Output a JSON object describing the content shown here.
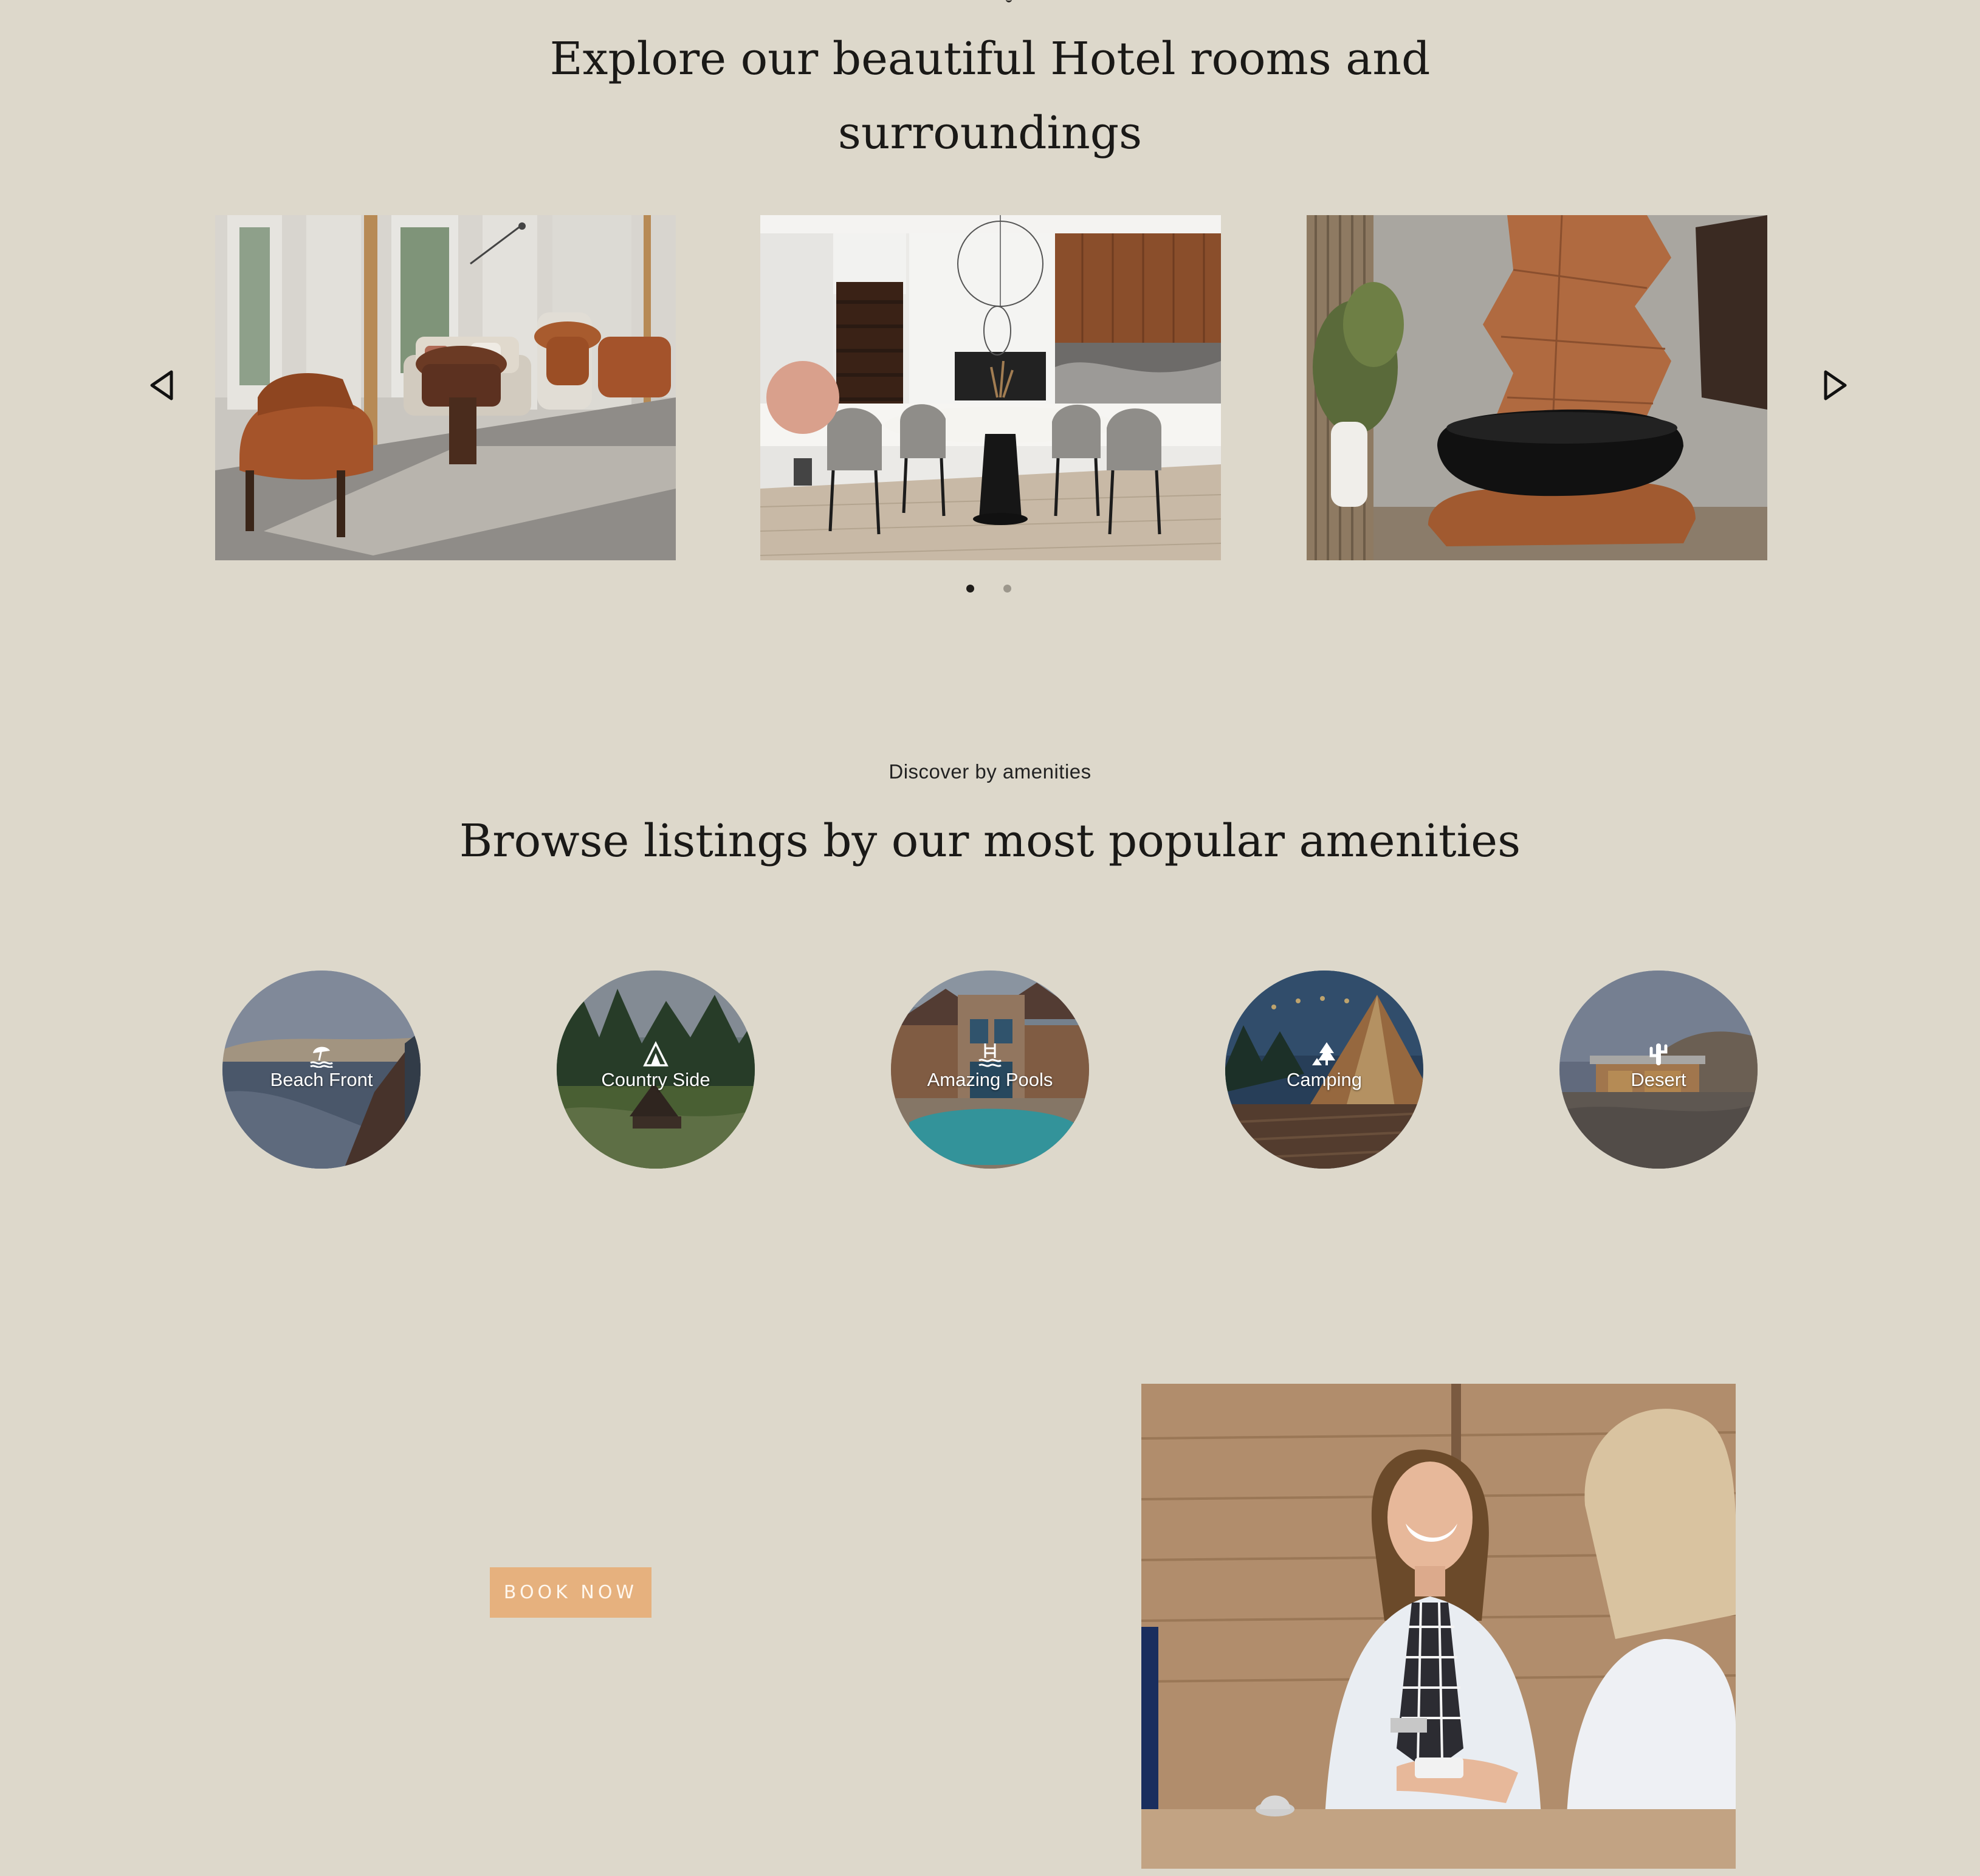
{
  "rooms_section": {
    "heading_line1": "Explore our beautiful Hotel rooms and",
    "heading_line2": "surroundings",
    "slides": [
      {
        "name": "lounge-photo"
      },
      {
        "name": "dining-kitchen-photo"
      },
      {
        "name": "bathroom-photo"
      }
    ],
    "prev_icon": "triangle-left-icon",
    "next_icon": "triangle-right-icon",
    "pagination": {
      "pages": 2,
      "active": 1
    }
  },
  "amenities_section": {
    "eyebrow": "Discover by amenities",
    "heading": "Browse listings by our most popular amenities",
    "items": [
      {
        "label": "Beach Front",
        "icon": "beach-umbrella-icon"
      },
      {
        "label": "Country Side",
        "icon": "a-frame-cabin-icon"
      },
      {
        "label": "Amazing Pools",
        "icon": "pool-ladder-icon"
      },
      {
        "label": "Camping",
        "icon": "tent-tree-icon"
      },
      {
        "label": "Desert",
        "icon": "cactus-icon"
      }
    ]
  },
  "booking_section": {
    "button_label": "BOOK NOW",
    "photo": "hotel-reception-photo"
  },
  "colors": {
    "background": "#ddd8cb",
    "accent_button": "#e6b17e",
    "text": "#1a1917"
  }
}
